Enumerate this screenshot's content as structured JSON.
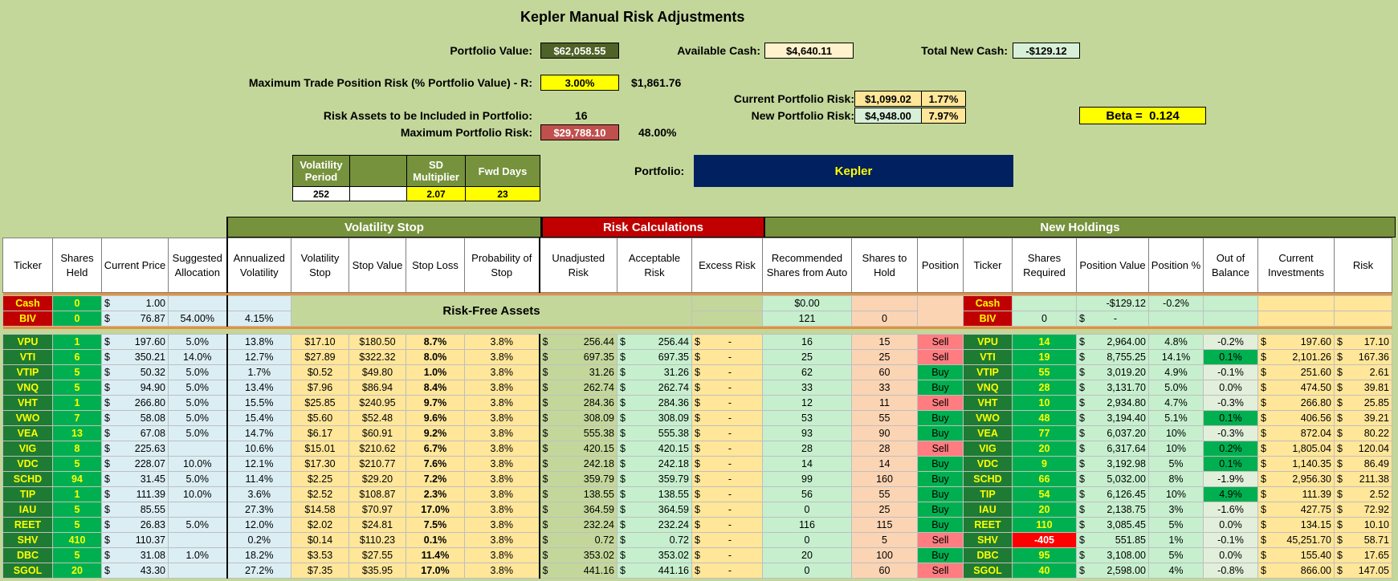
{
  "title": "Kepler Manual Risk Adjustments",
  "portfolio_value_label": "Portfolio Value:",
  "portfolio_value": "$62,058.55",
  "available_cash_label": "Available Cash:",
  "available_cash": "$4,640.11",
  "total_new_cash_label": "Total New Cash:",
  "total_new_cash": "-$129.12",
  "max_trade_risk_label": "Maximum Trade Position Risk (% Portfolio Value) - R:",
  "max_trade_risk_pct": "3.00%",
  "max_trade_risk_value": "$1,861.76",
  "current_risk_label": "Current Portfolio Risk:",
  "current_risk_value": "$1,099.02",
  "current_risk_pct": "1.77%",
  "new_risk_label": "New Portfolio Risk:",
  "new_risk_value": "$4,948.00",
  "new_risk_pct": "7.97%",
  "beta_label": "Beta =",
  "beta_value": "0.124",
  "risk_assets_label": "Risk Assets to be Included in Portfolio:",
  "risk_assets_count": "16",
  "max_portfolio_risk_label": "Maximum Portfolio Risk:",
  "max_portfolio_risk_value": "$29,788.10",
  "max_portfolio_risk_pct": "48.00%",
  "portfolio_label": "Portfolio:",
  "portfolio_name": "Kepler",
  "vol_table": {
    "headers": [
      "Volatility Period",
      "",
      "SD Multiplier",
      "Fwd Days"
    ],
    "values": [
      "252",
      "",
      "2.07",
      "23"
    ]
  },
  "sections": [
    "Volatility Stop",
    "Risk Calculations",
    "New Holdings"
  ],
  "columns": [
    "Ticker",
    "Shares Held",
    "Current Price",
    "Suggested Allocation",
    "Annualized Volatility",
    "Volatility Stop",
    "Stop Value",
    "Stop Loss",
    "Probability of Stop",
    "Unadjusted Risk",
    "Acceptable Risk",
    "Excess Risk",
    "Recommended Shares from Auto",
    "Shares to Hold",
    "Position",
    "Ticker",
    "Shares Required",
    "Position Value",
    "Position %",
    "Out of Balance",
    "Current Investments",
    "Risk"
  ],
  "risk_free_label": "Risk-Free Assets",
  "cash_row": {
    "ticker": "Cash",
    "held": "0",
    "price": "1.00",
    "rec": "$0.00",
    "ticker2": "Cash",
    "posval": "-$129.12",
    "pospct": "-0.2%"
  },
  "biv_row": {
    "ticker": "BIV",
    "held": "0",
    "price": "76.87",
    "alloc": "54.00%",
    "vol": "4.15%",
    "rec": "121",
    "hold": "0",
    "ticker2": "BIV",
    "req": "0",
    "posval": "-"
  },
  "currency": "$",
  "dash": "-",
  "rows": [
    {
      "t": "VPU",
      "h": "1",
      "p": "197.60",
      "a": "5.0%",
      "v": "13.8%",
      "vs": "$17.10",
      "sv": "$180.50",
      "sl": "8.7%",
      "ps": "3.8%",
      "ur": "256.44",
      "ar": "256.44",
      "rec": "16",
      "hold": "15",
      "pos": "Sell",
      "req": "14",
      "pv": "2,964.00",
      "pp": "4.8%",
      "ob": "-0.2%",
      "ci": "197.60",
      "rk": "17.10"
    },
    {
      "t": "VTI",
      "h": "6",
      "p": "350.21",
      "a": "14.0%",
      "v": "12.7%",
      "vs": "$27.89",
      "sv": "$322.32",
      "sl": "8.0%",
      "ps": "3.8%",
      "ur": "697.35",
      "ar": "697.35",
      "rec": "25",
      "hold": "25",
      "pos": "Sell",
      "req": "19",
      "pv": "8,755.25",
      "pp": "14.1%",
      "ob": "0.1%",
      "ci": "2,101.26",
      "rk": "167.36"
    },
    {
      "t": "VTIP",
      "h": "5",
      "p": "50.32",
      "a": "5.0%",
      "v": "1.7%",
      "vs": "$0.52",
      "sv": "$49.80",
      "sl": "1.0%",
      "ps": "3.8%",
      "ur": "31.26",
      "ar": "31.26",
      "rec": "62",
      "hold": "60",
      "pos": "Buy",
      "req": "55",
      "pv": "3,019.20",
      "pp": "4.9%",
      "ob": "-0.1%",
      "ci": "251.60",
      "rk": "2.61"
    },
    {
      "t": "VNQ",
      "h": "5",
      "p": "94.90",
      "a": "5.0%",
      "v": "13.4%",
      "vs": "$7.96",
      "sv": "$86.94",
      "sl": "8.4%",
      "ps": "3.8%",
      "ur": "262.74",
      "ar": "262.74",
      "rec": "33",
      "hold": "33",
      "pos": "Buy",
      "req": "28",
      "pv": "3,131.70",
      "pp": "5.0%",
      "ob": "0.0%",
      "ci": "474.50",
      "rk": "39.81"
    },
    {
      "t": "VHT",
      "h": "1",
      "p": "266.80",
      "a": "5.0%",
      "v": "15.5%",
      "vs": "$25.85",
      "sv": "$240.95",
      "sl": "9.7%",
      "ps": "3.8%",
      "ur": "284.36",
      "ar": "284.36",
      "rec": "12",
      "hold": "11",
      "pos": "Sell",
      "req": "10",
      "pv": "2,934.80",
      "pp": "4.7%",
      "ob": "-0.3%",
      "ci": "266.80",
      "rk": "25.85"
    },
    {
      "t": "VWO",
      "h": "7",
      "p": "58.08",
      "a": "5.0%",
      "v": "15.4%",
      "vs": "$5.60",
      "sv": "$52.48",
      "sl": "9.6%",
      "ps": "3.8%",
      "ur": "308.09",
      "ar": "308.09",
      "rec": "53",
      "hold": "55",
      "pos": "Buy",
      "req": "48",
      "pv": "3,194.40",
      "pp": "5.1%",
      "ob": "0.1%",
      "ci": "406.56",
      "rk": "39.21"
    },
    {
      "t": "VEA",
      "h": "13",
      "p": "67.08",
      "a": "5.0%",
      "v": "14.7%",
      "vs": "$6.17",
      "sv": "$60.91",
      "sl": "9.2%",
      "ps": "3.8%",
      "ur": "555.38",
      "ar": "555.38",
      "rec": "93",
      "hold": "90",
      "pos": "Buy",
      "req": "77",
      "pv": "6,037.20",
      "pp": "10%",
      "ob": "-0.3%",
      "ci": "872.04",
      "rk": "80.22"
    },
    {
      "t": "VIG",
      "h": "8",
      "p": "225.63",
      "a": "",
      "v": "10.6%",
      "vs": "$15.01",
      "sv": "$210.62",
      "sl": "6.7%",
      "ps": "3.8%",
      "ur": "420.15",
      "ar": "420.15",
      "rec": "28",
      "hold": "28",
      "pos": "Sell",
      "req": "20",
      "pv": "6,317.64",
      "pp": "10%",
      "ob": "0.2%",
      "ci": "1,805.04",
      "rk": "120.04"
    },
    {
      "t": "VDC",
      "h": "5",
      "p": "228.07",
      "a": "10.0%",
      "v": "12.1%",
      "vs": "$17.30",
      "sv": "$210.77",
      "sl": "7.6%",
      "ps": "3.8%",
      "ur": "242.18",
      "ar": "242.18",
      "rec": "14",
      "hold": "14",
      "pos": "Buy",
      "req": "9",
      "pv": "3,192.98",
      "pp": "5%",
      "ob": "0.1%",
      "ci": "1,140.35",
      "rk": "86.49"
    },
    {
      "t": "SCHD",
      "h": "94",
      "p": "31.45",
      "a": "5.0%",
      "v": "11.4%",
      "vs": "$2.25",
      "sv": "$29.20",
      "sl": "7.2%",
      "ps": "3.8%",
      "ur": "359.79",
      "ar": "359.79",
      "rec": "99",
      "hold": "160",
      "pos": "Buy",
      "req": "66",
      "pv": "5,032.00",
      "pp": "8%",
      "ob": "-1.9%",
      "ci": "2,956.30",
      "rk": "211.38"
    },
    {
      "t": "TIP",
      "h": "1",
      "p": "111.39",
      "a": "10.0%",
      "v": "3.6%",
      "vs": "$2.52",
      "sv": "$108.87",
      "sl": "2.3%",
      "ps": "3.8%",
      "ur": "138.55",
      "ar": "138.55",
      "rec": "56",
      "hold": "55",
      "pos": "Buy",
      "req": "54",
      "pv": "6,126.45",
      "pp": "10%",
      "ob": "4.9%",
      "ci": "111.39",
      "rk": "2.52"
    },
    {
      "t": "IAU",
      "h": "5",
      "p": "85.55",
      "a": "",
      "v": "27.3%",
      "vs": "$14.58",
      "sv": "$70.97",
      "sl": "17.0%",
      "ps": "3.8%",
      "ur": "364.59",
      "ar": "364.59",
      "rec": "0",
      "hold": "25",
      "pos": "Buy",
      "req": "20",
      "pv": "2,138.75",
      "pp": "3%",
      "ob": "-1.6%",
      "ci": "427.75",
      "rk": "72.92"
    },
    {
      "t": "REET",
      "h": "5",
      "p": "26.83",
      "a": "5.0%",
      "v": "12.0%",
      "vs": "$2.02",
      "sv": "$24.81",
      "sl": "7.5%",
      "ps": "3.8%",
      "ur": "232.24",
      "ar": "232.24",
      "rec": "116",
      "hold": "115",
      "pos": "Buy",
      "req": "110",
      "pv": "3,085.45",
      "pp": "5%",
      "ob": "0.0%",
      "ci": "134.15",
      "rk": "10.10"
    },
    {
      "t": "SHV",
      "h": "410",
      "p": "110.37",
      "a": "",
      "v": "0.2%",
      "vs": "$0.14",
      "sv": "$110.23",
      "sl": "0.1%",
      "ps": "3.8%",
      "ur": "0.72",
      "ar": "0.72",
      "rec": "0",
      "hold": "5",
      "pos": "Sell",
      "req": "-405",
      "pv": "551.85",
      "pp": "1%",
      "ob": "-0.1%",
      "ci": "45,251.70",
      "rk": "58.71"
    },
    {
      "t": "DBC",
      "h": "5",
      "p": "31.08",
      "a": "1.0%",
      "v": "18.2%",
      "vs": "$3.53",
      "sv": "$27.55",
      "sl": "11.4%",
      "ps": "3.8%",
      "ur": "353.02",
      "ar": "353.02",
      "rec": "20",
      "hold": "100",
      "pos": "Buy",
      "req": "95",
      "pv": "3,108.00",
      "pp": "5%",
      "ob": "0.0%",
      "ci": "155.40",
      "rk": "17.65"
    },
    {
      "t": "SGOL",
      "h": "20",
      "p": "43.30",
      "a": "",
      "v": "27.2%",
      "vs": "$7.35",
      "sv": "$35.95",
      "sl": "17.0%",
      "ps": "3.8%",
      "ur": "441.16",
      "ar": "441.16",
      "rec": "0",
      "hold": "60",
      "pos": "Sell",
      "req": "40",
      "pv": "2,598.00",
      "pp": "4%",
      "ob": "-0.8%",
      "ci": "866.00",
      "rk": "147.05"
    }
  ],
  "colors": {
    "background": "#c4d79b",
    "olive": "#76923c",
    "red": "#c00000",
    "navy": "#002060",
    "yellow": "#ffff00"
  }
}
